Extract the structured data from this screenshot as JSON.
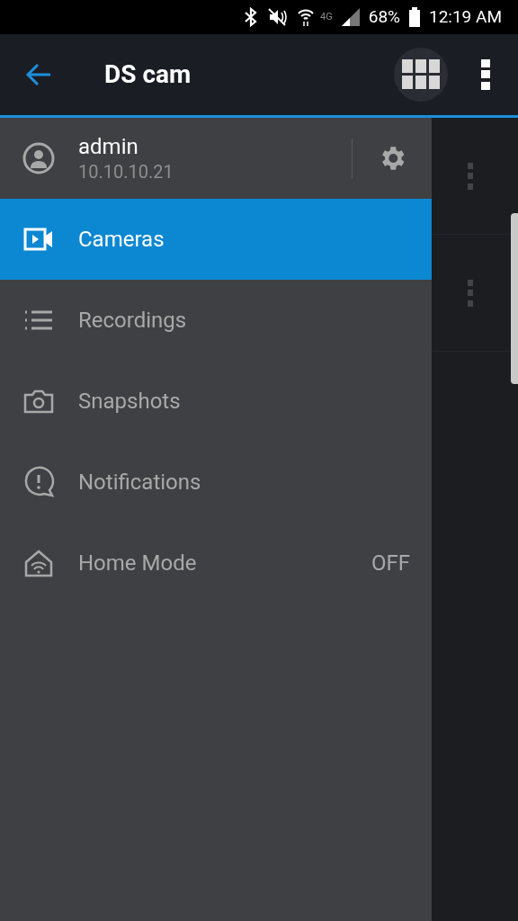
{
  "status_bar": {
    "network": "4G",
    "battery": "68%",
    "time": "12:19 AM"
  },
  "app_bar": {
    "title": "DS cam"
  },
  "drawer": {
    "user": {
      "name": "admin",
      "address": "10.10.10.21"
    },
    "items": [
      {
        "kind": "video",
        "label": "Cameras",
        "selected": true
      },
      {
        "kind": "list",
        "label": "Recordings",
        "selected": false
      },
      {
        "kind": "camera",
        "label": "Snapshots",
        "selected": false
      },
      {
        "kind": "alert",
        "label": "Notifications",
        "selected": false
      },
      {
        "kind": "home",
        "label": "Home Mode",
        "selected": false,
        "value": "OFF"
      }
    ]
  }
}
